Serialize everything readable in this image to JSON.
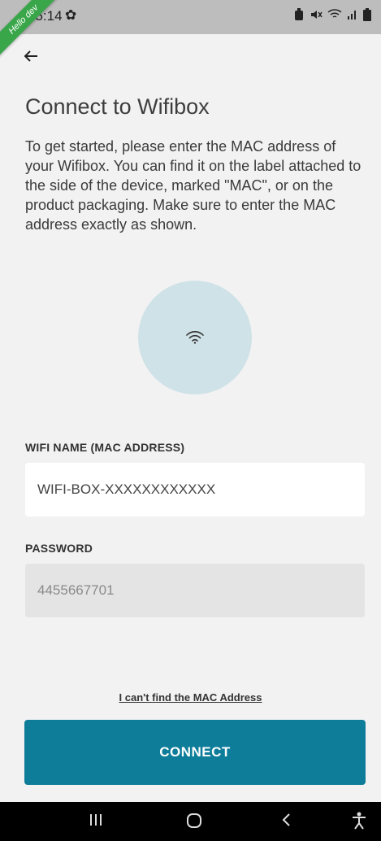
{
  "status_bar": {
    "time": "15:14",
    "ribbon_text": "Hello dev"
  },
  "page": {
    "title": "Connect to Wifibox",
    "intro": "To get started, please enter the MAC address of your Wifibox. You can find it on the label attached to the side of the device, marked \"MAC\", or on the product packaging. Make sure to enter the MAC address exactly as shown."
  },
  "form": {
    "mac_label": "WIFI NAME (MAC ADDRESS)",
    "mac_value": "WIFI-BOX-XXXXXXXXXXXX",
    "password_label": "PASSWORD",
    "password_value": "4455667701"
  },
  "help_link": "I can't find the MAC Address",
  "connect_label": "CONNECT",
  "colors": {
    "accent": "#0e7d99",
    "circle": "#cfe2e7",
    "background": "#f2f2f2"
  }
}
